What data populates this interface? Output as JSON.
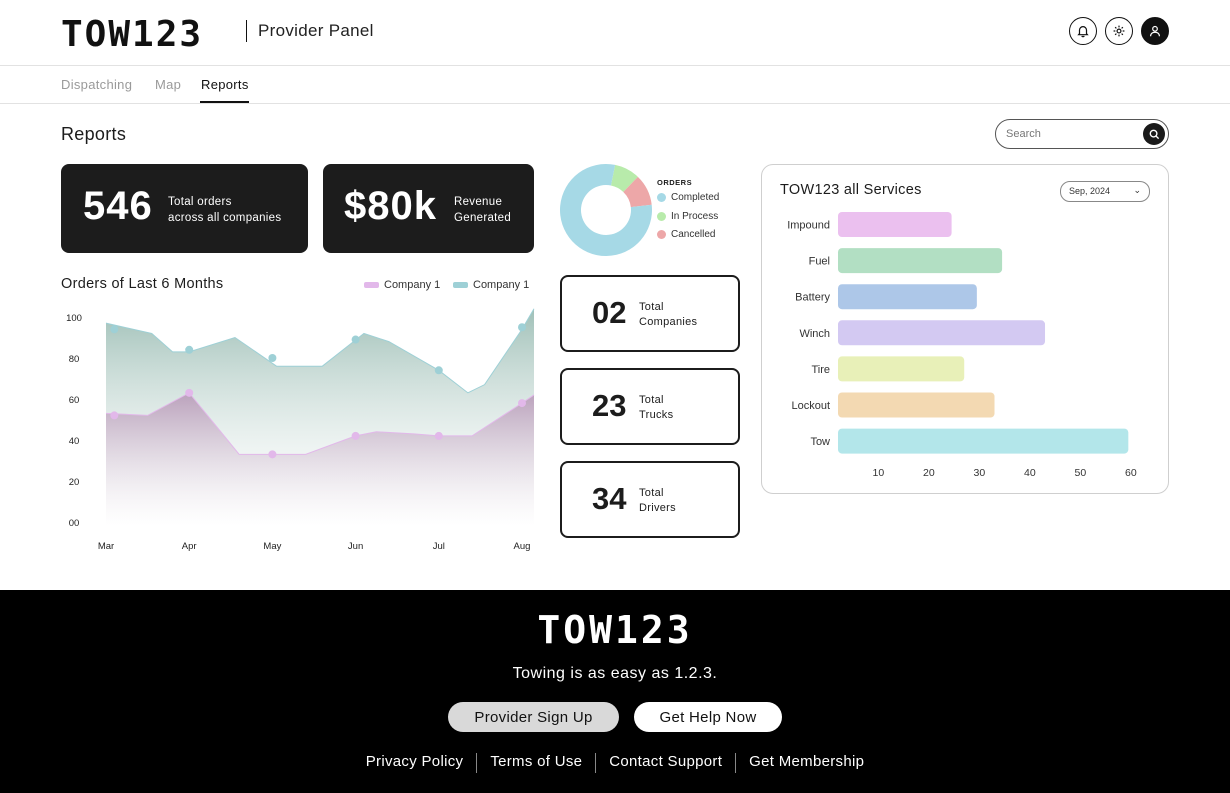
{
  "header": {
    "logo": "TOW123",
    "title": "Provider Panel",
    "icons": [
      "bell-icon",
      "gear-icon",
      "user-icon"
    ]
  },
  "nav": {
    "tabs": [
      {
        "label": "Dispatching",
        "active": false
      },
      {
        "label": "Map",
        "active": false
      },
      {
        "label": "Reports",
        "active": true
      }
    ]
  },
  "page": {
    "title": "Reports",
    "search_placeholder": "Search"
  },
  "stats": {
    "orders": {
      "value": "546",
      "label_line1": "Total orders",
      "label_line2": "across all companies"
    },
    "revenue": {
      "value": "$80k",
      "label_line1": "Revenue",
      "label_line2": "Generated"
    },
    "companies": {
      "value": "02",
      "label_line1": "Total",
      "label_line2": "Companies"
    },
    "trucks": {
      "value": "23",
      "label_line1": "Total",
      "label_line2": "Trucks"
    },
    "drivers": {
      "value": "34",
      "label_line1": "Total",
      "label_line2": "Drivers"
    }
  },
  "colors": {
    "dark": "#1c1c1c",
    "teal": "#a6d5e3",
    "green": "#b8e9a7",
    "red": "#eca3a3",
    "purple_area": "#b89ab8",
    "teal_area": "#8fb5ab"
  },
  "chart_data": [
    {
      "type": "area",
      "title": "Orders of Last 6 Months",
      "categories": [
        "Mar",
        "Apr",
        "May",
        "Jun",
        "Jul",
        "Aug"
      ],
      "y_ticks": [
        "00",
        "20",
        "40",
        "60",
        "80",
        "100"
      ],
      "ylim": [
        0,
        100
      ],
      "legend": "top-right",
      "series": [
        {
          "name": "Company 1",
          "color": "#e2b8ea",
          "points_x": [
            0,
            0.5,
            1,
            1.6,
            2,
            2.4,
            3,
            3.25,
            3.7,
            4,
            4.4,
            5,
            5.15
          ],
          "values": [
            53,
            52,
            63,
            33,
            33,
            33,
            42,
            44,
            43,
            42,
            42,
            58,
            62
          ],
          "markers_x": [
            0.1,
            1,
            2,
            3,
            4,
            5
          ],
          "markers_y": [
            52,
            63,
            33,
            42,
            42,
            58
          ]
        },
        {
          "name": "Company 1",
          "color": "#9ed0d6",
          "points_x": [
            0,
            0.55,
            0.8,
            1,
            1.55,
            2.05,
            2.6,
            3.1,
            3.4,
            4,
            4.35,
            4.55,
            5,
            5.15
          ],
          "values": [
            97,
            92,
            83,
            83,
            90,
            76,
            76,
            92,
            88,
            74,
            63,
            67,
            94,
            104
          ],
          "markers_x": [
            0.1,
            1,
            2,
            3,
            4,
            5
          ],
          "markers_y": [
            94,
            84,
            80,
            89,
            74,
            95
          ]
        }
      ]
    },
    {
      "type": "pie",
      "title": "ORDERS",
      "categories": [
        "Completed",
        "In Process",
        "Cancelled"
      ],
      "values": [
        80,
        9,
        11
      ],
      "colors": [
        "#a6d9e6",
        "#b8ebab",
        "#eda7a8"
      ]
    },
    {
      "type": "bar",
      "orientation": "horizontal",
      "title": "TOW123 all Services",
      "filter": "Sep, 2024",
      "categories": [
        "Impound",
        "Fuel",
        "Battery",
        "Winch",
        "Tire",
        "Lockout",
        "Tow"
      ],
      "values": [
        24.5,
        34.5,
        29.5,
        43,
        27,
        33,
        59.5
      ],
      "colors": [
        "#ebc0ef",
        "#b2dfc3",
        "#adc7e8",
        "#d3c9f2",
        "#e8f0b8",
        "#f3d9b2",
        "#b3e6ea"
      ],
      "x_ticks": [
        10,
        20,
        30,
        40,
        50,
        60
      ],
      "xlim": [
        2,
        63
      ]
    }
  ],
  "footer": {
    "logo": "TOW123",
    "tagline": "Towing is as easy as 1.2.3.",
    "signup_label": "Provider Sign Up",
    "help_label": "Get Help Now",
    "links": [
      "Privacy Policy",
      "Terms of Use",
      "Contact Support",
      "Get Membership"
    ]
  }
}
